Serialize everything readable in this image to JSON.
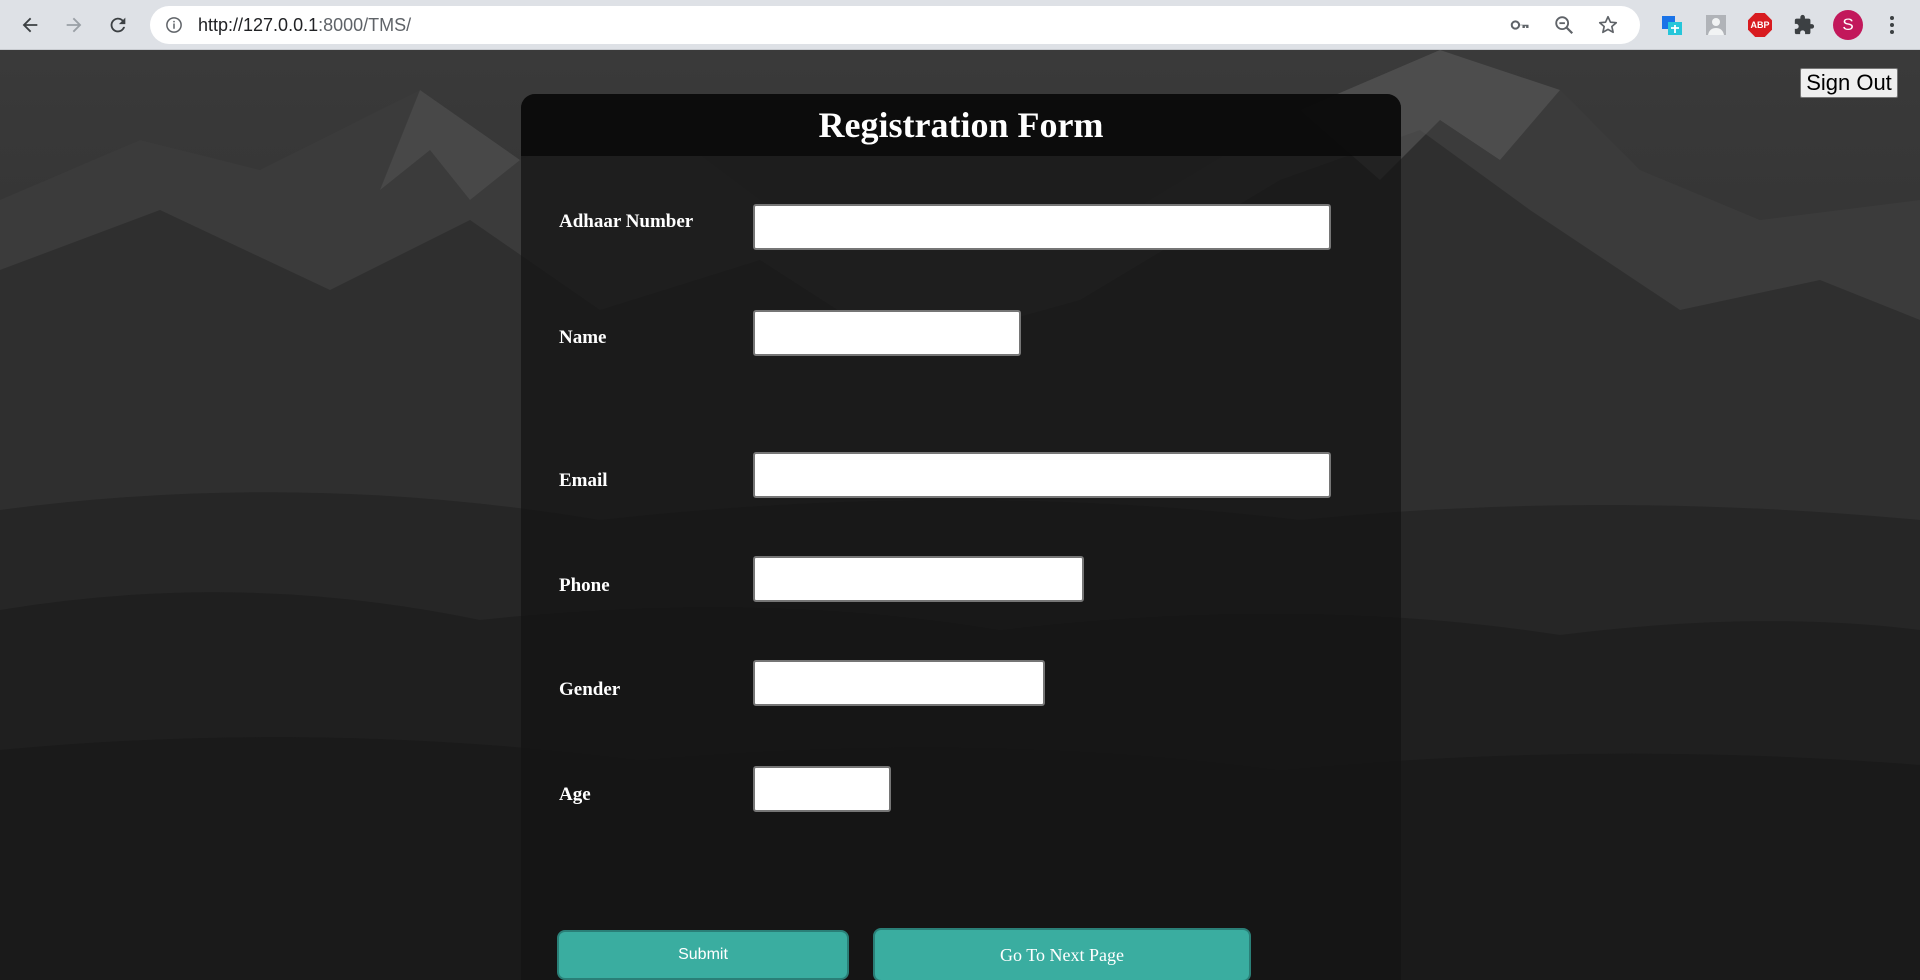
{
  "browser": {
    "url_host": "http://127.0.0.1",
    "url_rest": ":8000/TMS/",
    "profile_initial": "S",
    "adblock_label": "ABP",
    "icons": [
      "back-icon",
      "forward-icon",
      "reload-icon",
      "info-icon",
      "key-icon",
      "zoom-out-icon",
      "star-icon",
      "translate-extension-icon",
      "profile-extension-icon",
      "adblock-extension-icon",
      "puzzle-icon",
      "kebab-menu-icon"
    ]
  },
  "page": {
    "signout_label": "Sign Out",
    "form": {
      "title": "Registration Form",
      "fields": [
        {
          "label": "Adhaar Number",
          "value": ""
        },
        {
          "label": "Name",
          "value": ""
        },
        {
          "label": "Email",
          "value": ""
        },
        {
          "label": "Phone",
          "value": ""
        },
        {
          "label": "Gender",
          "value": ""
        },
        {
          "label": "Age",
          "value": ""
        }
      ],
      "submit_label": "Submit",
      "next_label": "Go To Next Page"
    }
  },
  "colors": {
    "button_accent": "#3aada0",
    "card_header": "#0f0f0f",
    "avatar": "#c2185b"
  }
}
